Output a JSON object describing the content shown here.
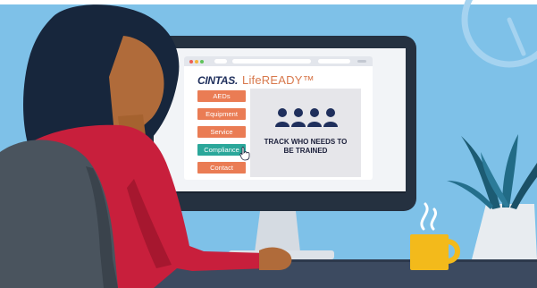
{
  "site": {
    "brand": "CINTAS.",
    "product": "LifeREADY™",
    "nav": [
      {
        "label": "AEDs"
      },
      {
        "label": "Equipment"
      },
      {
        "label": "Service"
      },
      {
        "label": "Compliance"
      },
      {
        "label": "Contact"
      }
    ],
    "active_item": "Compliance",
    "panel_text": "TRACK WHO NEEDS TO BE TRAINED"
  },
  "colors": {
    "background": "#7ec1e8",
    "monitor_frame": "#253140",
    "nav_button": "#ea7c54",
    "nav_active": "#2ba79a",
    "brand_navy": "#1f2f5c",
    "product_orange": "#d8794d",
    "shirt": "#c81f3c",
    "hair": "#17263c",
    "skin": "#b06b3a",
    "mug": "#f3ba1b"
  }
}
